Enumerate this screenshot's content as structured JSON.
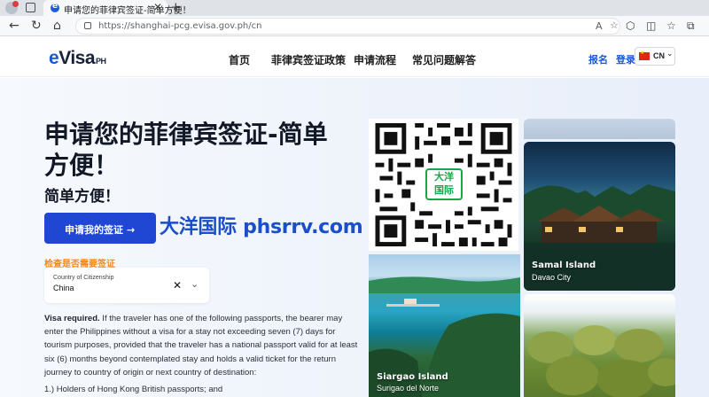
{
  "browser": {
    "tab_title": "申请您的菲律宾签证-简单方便！",
    "tab_close": "✕",
    "new_tab": "+",
    "url": "https://shanghai-pcg.evisa.gov.ph/cn",
    "icons": [
      "profile-icon",
      "workspaces-icon",
      "tab-actions-icon",
      "back-icon",
      "refresh-icon",
      "home-icon",
      "lock-icon",
      "read-aloud-icon",
      "favorite-icon",
      "extensions-icon",
      "split-screen-icon",
      "favorites-bar-icon",
      "collections-icon"
    ]
  },
  "header": {
    "logo_e": "e",
    "logo_main": "Visa",
    "logo_suffix": "PH",
    "nav": [
      "首页",
      "菲律宾签证政策",
      "申请流程",
      "常见问题解答"
    ],
    "signup": "报名",
    "login": "登录",
    "language": "CN",
    "language_chevron": "⌄"
  },
  "hero": {
    "title": "申请您的菲律宾签证-简单方便！",
    "subtitle": "简单方便！",
    "cta_label": "申请我的签证",
    "cta_arrow": "→",
    "watermark": "大洋国际 phsrrv.com",
    "eligibility_label": "检查是否需要签证",
    "country_field": {
      "label": "Country of Citizenship",
      "value": "China",
      "clear": "✕",
      "chevron": "⌄"
    },
    "notice_bold": "Visa required.",
    "notice_text": " If the traveler has one of the following passports, the bearer may enter the Philippines without a visa for a stay not exceeding seven (7) days for tourism purposes, provided that the traveler has a national passport valid for at least six (6) months beyond contemplated stay and holds a valid ticket for the return journey to country of origin or next country of destination:",
    "list_item_1": "1.) Holders of Hong Kong British passports; and"
  },
  "qr": {
    "logo_line1": "大洋",
    "logo_line2": "国际"
  },
  "photos": {
    "samal": {
      "title": "Samal Island",
      "location": "Davao City"
    },
    "siargao": {
      "title": "Siargao Island",
      "location": "Surigao del Norte"
    }
  },
  "colors": {
    "brand_blue": "#1f47d3",
    "accent_orange": "#f18a1e",
    "qr_green": "#18a64a"
  }
}
